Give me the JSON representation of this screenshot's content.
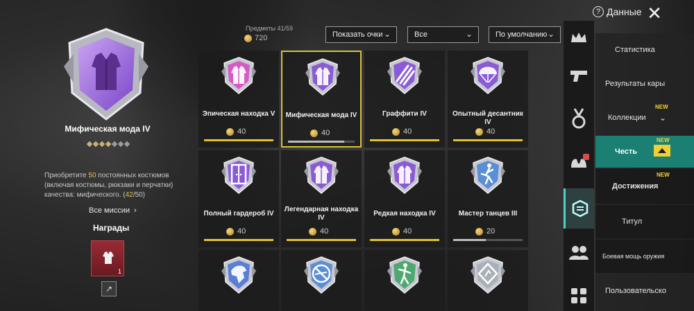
{
  "header": {
    "help_label": "Данные",
    "help_icon": "question-circle-icon",
    "close_icon": "close-icon"
  },
  "detail": {
    "title": "Мифическая мода IV",
    "stars_filled": 4,
    "stars_total": 7,
    "description_prefix": "Приобретите ",
    "description_highlight": "50",
    "description_suffix": " постоянных костюмов (включая костюмы, рюкзаки и перчатки) качества: мифического. (",
    "progress_current": "42",
    "progress_rest": "/50)",
    "all_missions_label": "Все миссии",
    "rewards_label": "Награды",
    "reward_count": "1"
  },
  "stats": {
    "items_label": "Предметы 41/59",
    "coins_value": "720"
  },
  "filters": {
    "show_points": "Показать очки",
    "all": "Все",
    "sort": "По умолчанию"
  },
  "cards": [
    {
      "title": "Эпическая находка V",
      "points": "40",
      "progress": 1.0,
      "color": "#d65ac6",
      "icon": "jacket-icon",
      "selected": false
    },
    {
      "title": "Мифическая мода IV",
      "points": "40",
      "progress": 0.84,
      "color": "#8b5bd6",
      "icon": "jacket-icon",
      "selected": true
    },
    {
      "title": "Граффити IV",
      "points": "40",
      "progress": 1.0,
      "color": "#8b5bd6",
      "icon": "claw-icon",
      "selected": false
    },
    {
      "title": "Опытный десантник IV",
      "points": "40",
      "progress": 1.0,
      "color": "#8b5bd6",
      "icon": "parachute-icon",
      "selected": false
    },
    {
      "title": "Полный гардероб IV",
      "points": "40",
      "progress": 1.0,
      "color": "#8b5bd6",
      "icon": "wardrobe-icon",
      "selected": false
    },
    {
      "title": "Легендарная находка IV",
      "points": "40",
      "progress": 1.0,
      "color": "#8b5bd6",
      "icon": "jacket-icon",
      "selected": false
    },
    {
      "title": "Редкая находка IV",
      "points": "40",
      "progress": 1.0,
      "color": "#8b5bd6",
      "icon": "jacket-icon",
      "selected": false
    },
    {
      "title": "Мастер танцев III",
      "points": "20",
      "progress": 0.47,
      "color": "#5a8ed6",
      "icon": "dancer-icon",
      "selected": false
    },
    {
      "title": "",
      "points": "",
      "progress": null,
      "color": "#5a7ed6",
      "icon": "eagle-icon",
      "selected": false
    },
    {
      "title": "",
      "points": "",
      "progress": null,
      "color": "#5a8ed6",
      "icon": "no-gun-icon",
      "selected": false
    },
    {
      "title": "",
      "points": "",
      "progress": null,
      "color": "#4fa870",
      "icon": "fighter-icon",
      "selected": false
    },
    {
      "title": "",
      "points": "",
      "progress": null,
      "color": "#a8b0b8",
      "icon": "sign-icon",
      "selected": false
    }
  ],
  "side_icons": [
    "crown-icon",
    "pistol-icon",
    "medal-icon",
    "muscle-icon",
    "badge-tab-icon",
    "friends-icon",
    "grid-icon"
  ],
  "menu": {
    "stats": "Статистика",
    "map_results": "Результаты кары",
    "collections": "Коллекции",
    "honor": "Честь",
    "achievements": "Достижения",
    "title": "Титул",
    "weapon_power": "Боевая мощь оружия",
    "custom": "Пользовательско",
    "new_label": "NEW"
  },
  "colors": {
    "accent_yellow": "#e2c230",
    "teal_active": "#1c7f74",
    "mythic_purple": "#8b5bd6"
  }
}
